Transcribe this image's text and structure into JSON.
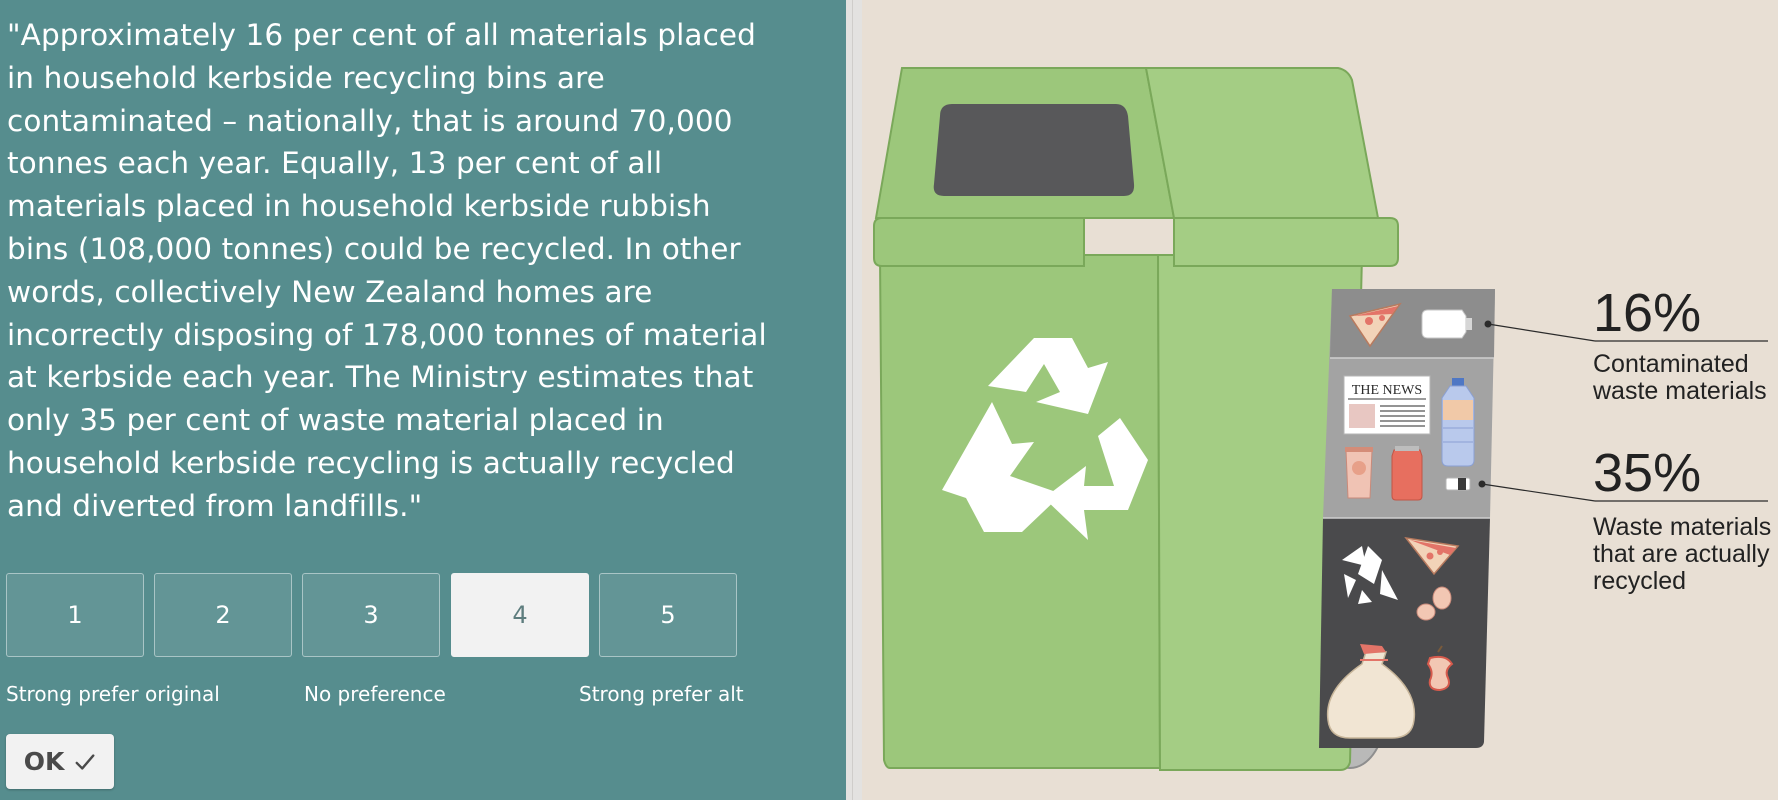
{
  "quote": "\"Approximately 16 per cent of all materials placed in household kerbside recycling bins are contaminated – nationally, that is around 70,000 tonnes each year. Equally, 13 per cent of all materials placed in household kerbside rubbish bins (108,000 tonnes) could be recycled. In other words, collectively New Zealand homes are incorrectly disposing of 178,000 tonnes of material at kerbside each year. The Ministry estimates that only 35 per cent of waste material placed in household kerbside recycling is actually recycled and diverted from landfills.\"",
  "rating": {
    "options": [
      "1",
      "2",
      "3",
      "4",
      "5"
    ],
    "selected": "4",
    "labels": {
      "left": "Strong prefer original",
      "middle": "No preference",
      "right": "Strong prefer alt"
    }
  },
  "ok_button": {
    "label": "OK",
    "icon": "checkmark-icon"
  },
  "infographic": {
    "newspaper_text": "THE NEWS",
    "stat_contaminated": {
      "value": "16%",
      "line1": "Contaminated",
      "line2": "waste materials"
    },
    "stat_recycled": {
      "value": "35%",
      "line1": "Waste materials",
      "line2": "that are actually",
      "line3": "recycled"
    },
    "colors": {
      "bin_green": "#9cc77b",
      "bin_dark_green": "#7aa85a",
      "window_gray": "#58585a",
      "panel_teal": "#568d8e"
    }
  }
}
